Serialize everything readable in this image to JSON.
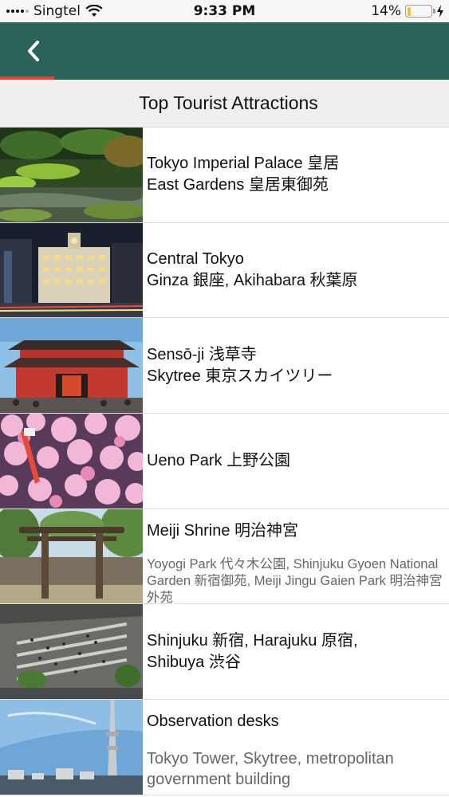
{
  "status_bar": {
    "carrier": "Singtel",
    "time": "9:33 PM",
    "battery": "14%",
    "battery_level": 0.14
  },
  "nav": {
    "back_icon": "chevron-left-icon",
    "progress": 0.12,
    "colors": {
      "nav_bg": "#2b6459",
      "progress": "#e0463a",
      "title_bg": "#efefef"
    }
  },
  "page": {
    "title": "Top Tourist Attractions"
  },
  "attractions": [
    {
      "line1": "Tokyo Imperial Palace 皇居",
      "line2": "East Gardens 皇居東御苑"
    },
    {
      "line1": "Central Tokyo",
      "line2": "Ginza 銀座, Akihabara 秋葉原"
    },
    {
      "line1": "Sensō-ji 浅草寺",
      "line2": "Skytree 東京スカイツリー"
    },
    {
      "line1": "Ueno Park 上野公園"
    },
    {
      "line1": "Meiji Shrine 明治神宮",
      "sub": "Yoyogi Park 代々木公園, Shinjuku Gyoen National Garden 新宿御苑, Meiji Jingu Gaien Park 明治神宮外苑"
    },
    {
      "line1": "Shinjuku 新宿, Harajuku 原宿,",
      "line2": "Shibuya 渋谷"
    },
    {
      "line1": "Observation desks",
      "sub": "Tokyo Tower, Skytree, metropolitan government building"
    }
  ]
}
